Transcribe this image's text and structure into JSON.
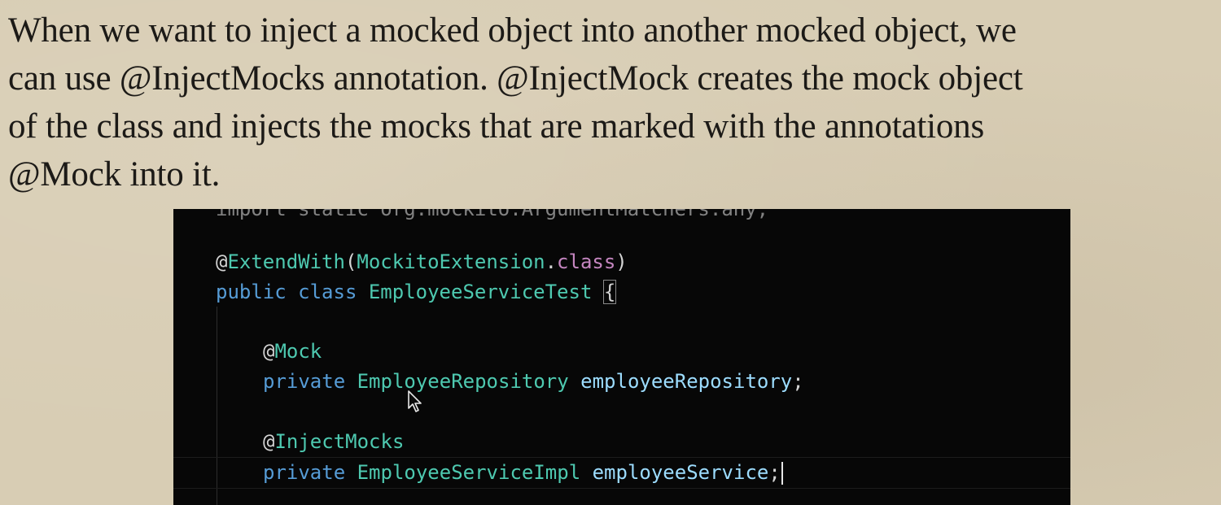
{
  "slide_text": "When we want to inject a mocked object into another mocked object, we\ncan use @InjectMocks annotation. @InjectMock creates the mock object\nof the class and injects the mocks that are marked with the annotations\n@Mock into it.",
  "code": {
    "cut_off_top_line": "import static org.mockito.ArgumentMatchers.any;",
    "extend_at": "@",
    "extend_name": "ExtendWith",
    "extend_open": "(",
    "extend_arg": "MockitoExtension",
    "extend_dot": ".",
    "extend_kw": "class",
    "extend_close": ")",
    "kw_public": "public",
    "kw_class": "class",
    "class_name": "EmployeeServiceTest",
    "open_brace": "{",
    "mock_at": "@",
    "mock_name": "Mock",
    "field1_mod": "private",
    "field1_type": "EmployeeRepository",
    "field1_name": "employeeRepository",
    "semicolon": ";",
    "inject_at": "@",
    "inject_name": "InjectMocks",
    "field2_mod": "private",
    "field2_type": "EmployeeServiceImpl",
    "field2_name": "employeeService"
  },
  "colors": {
    "keyword": "#569cd6",
    "type": "#4ec9b0",
    "variable": "#9cdcfe",
    "keyword_class": "#c586c0",
    "editor_bg": "#070707",
    "paper_bg": "#d8cdb4"
  },
  "icons": {
    "pointer": "mouse-pointer-icon"
  }
}
